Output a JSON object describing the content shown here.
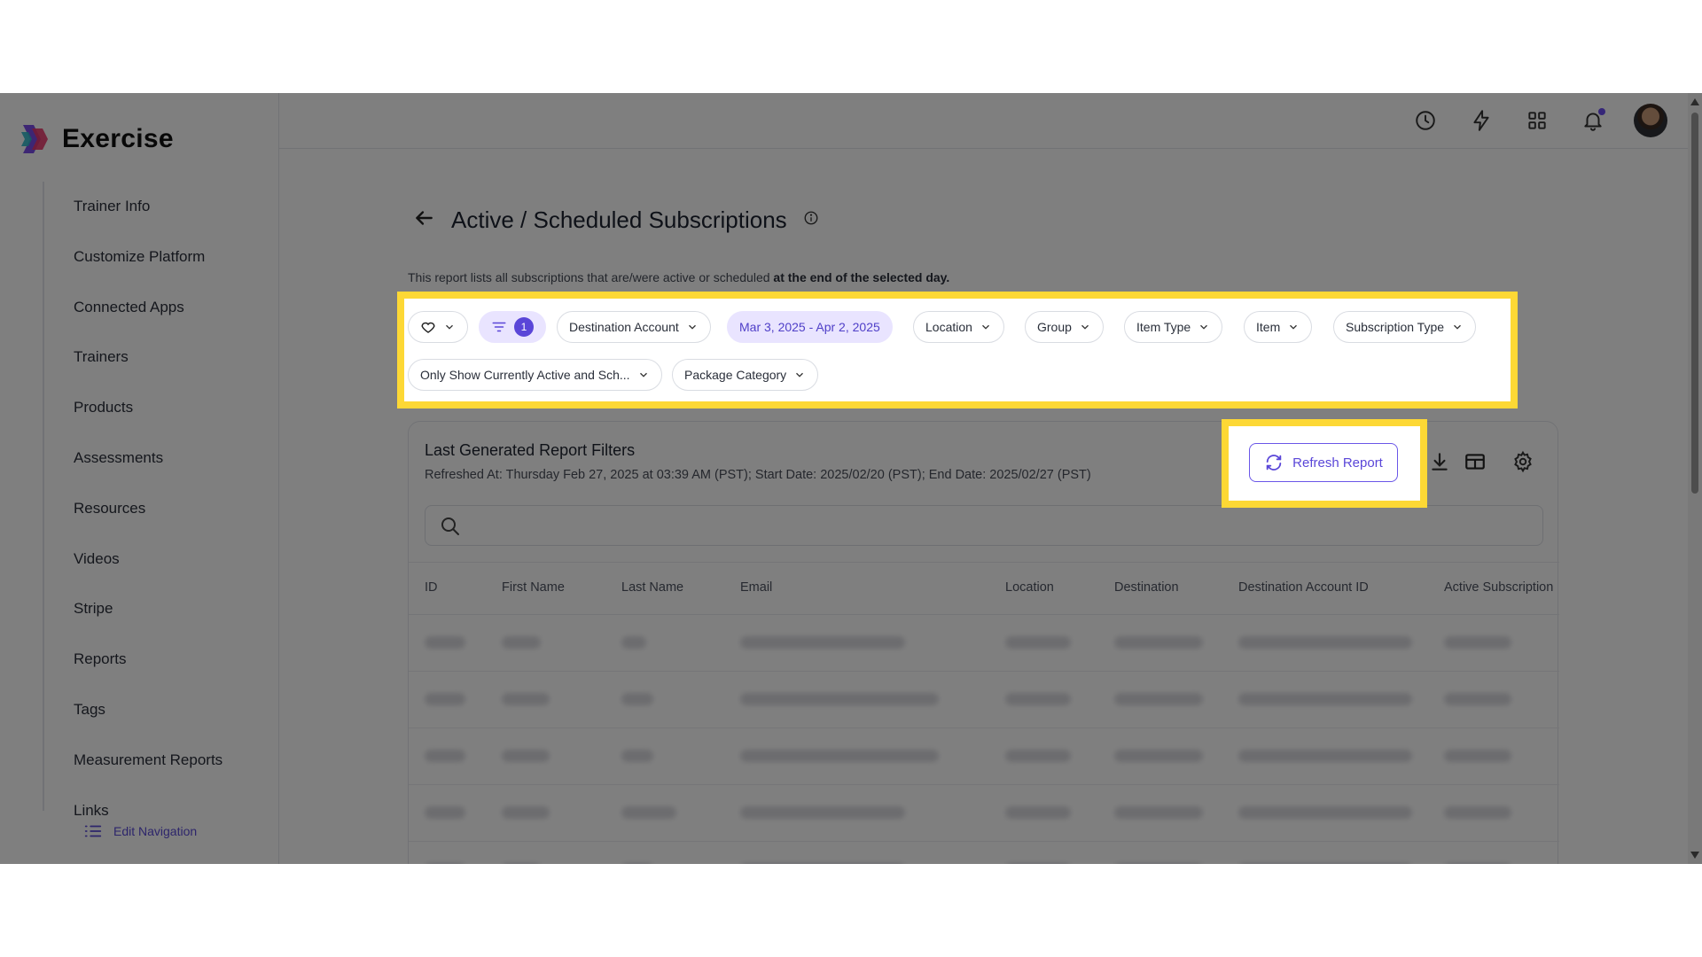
{
  "app": {
    "name": "Exercise"
  },
  "sidebar": {
    "items": [
      {
        "label": "Trainer Info"
      },
      {
        "label": "Customize Platform"
      },
      {
        "label": "Connected Apps"
      },
      {
        "label": "Trainers"
      },
      {
        "label": "Products"
      },
      {
        "label": "Assessments"
      },
      {
        "label": "Resources"
      },
      {
        "label": "Videos"
      },
      {
        "label": "Stripe"
      },
      {
        "label": "Reports"
      },
      {
        "label": "Tags"
      },
      {
        "label": "Measurement Reports"
      },
      {
        "label": "Links"
      }
    ],
    "edit_navigation": "Edit Navigation"
  },
  "header": {
    "title": "Active / Scheduled Subscriptions",
    "description_prefix": "This report lists all subscriptions that are/were active or scheduled ",
    "description_bold": "at the end of the selected day."
  },
  "filters": {
    "active_count": "1",
    "destination_account": "Destination Account",
    "date_range": "Mar 3, 2025 - Apr 2, 2025",
    "location": "Location",
    "group": "Group",
    "item_type": "Item Type",
    "item": "Item",
    "subscription_type": "Subscription Type",
    "only_show": "Only Show Currently Active and Sch...",
    "package_category": "Package Category"
  },
  "report": {
    "title": "Last Generated Report Filters",
    "refreshed": "Refreshed At: Thursday Feb 27, 2025 at 03:39 AM (PST); Start Date: 2025/02/20 (PST); End Date: 2025/02/27 (PST)",
    "refresh_label": "Refresh Report",
    "columns": [
      "ID",
      "First Name",
      "Last Name",
      "Email",
      "Location",
      "Destination",
      "Destination Account ID",
      "Active Subscription"
    ]
  },
  "colors": {
    "accent": "#5a46d8",
    "highlight": "#fdd835",
    "chip_active_bg": "#e9e4ff"
  }
}
